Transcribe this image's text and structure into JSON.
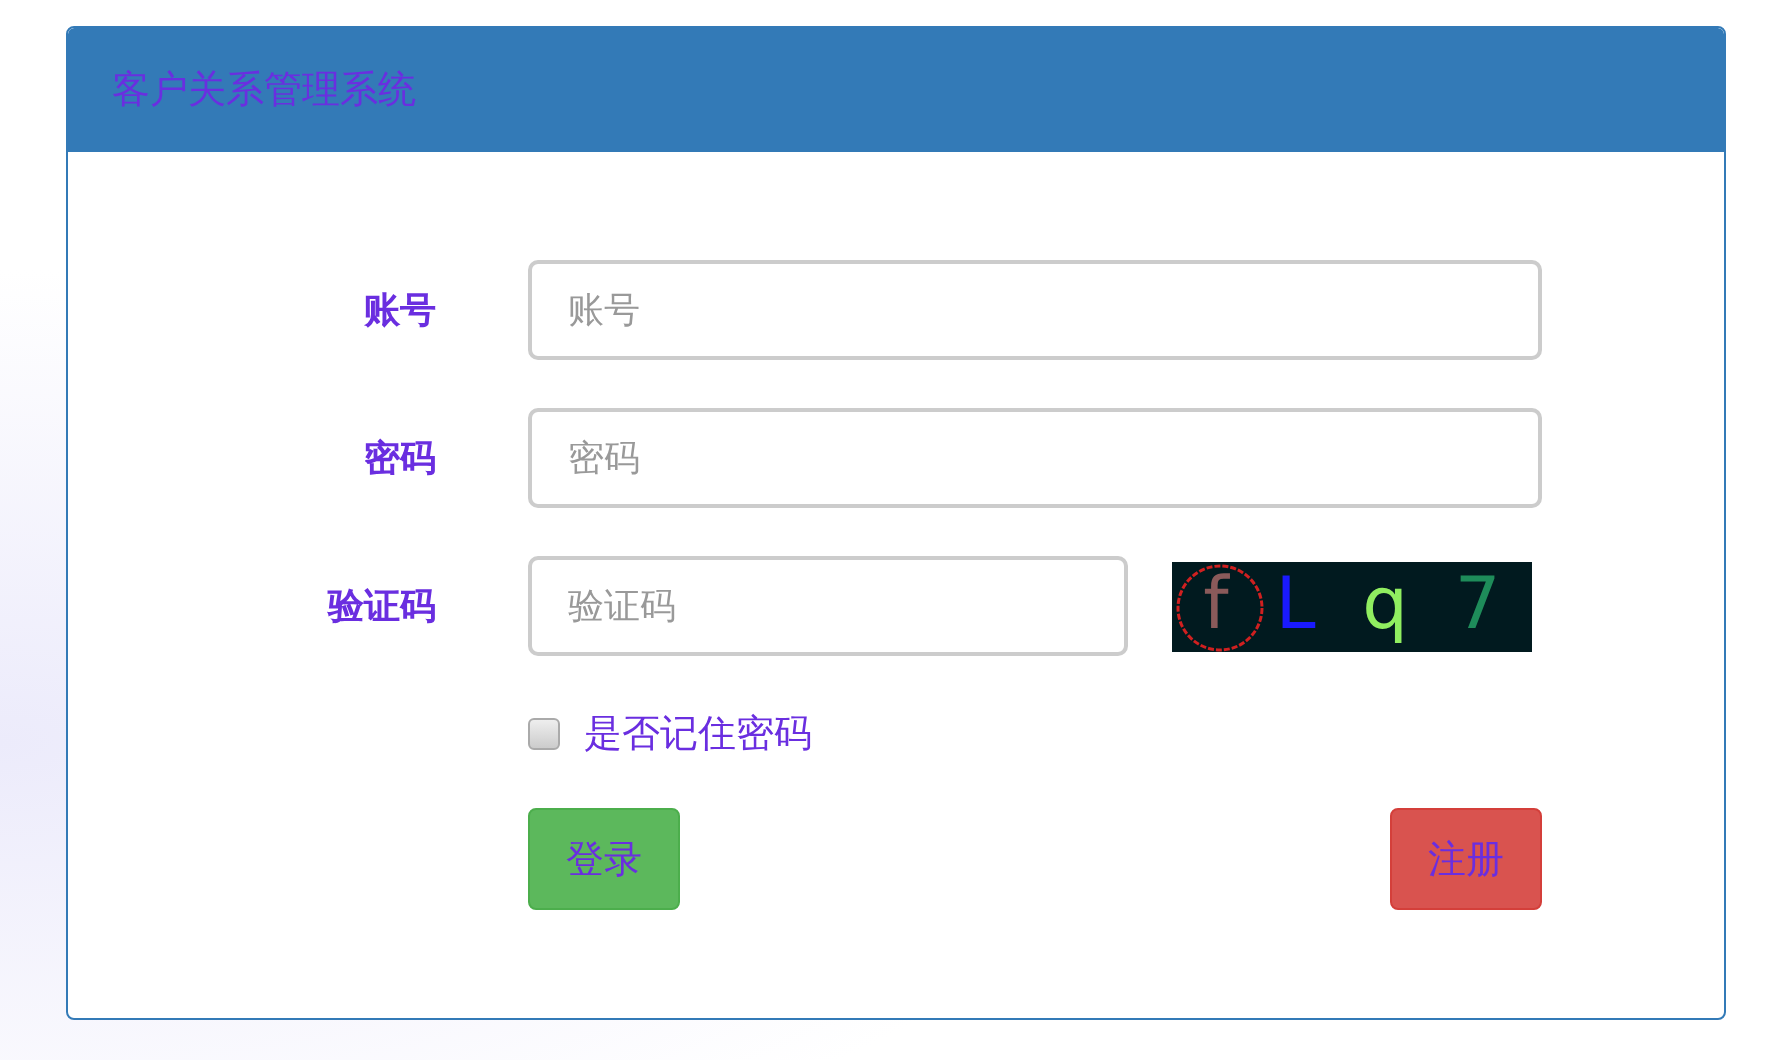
{
  "header": {
    "title": "客户关系管理系统"
  },
  "fields": [
    {
      "label": "账号",
      "placeholder": "账号",
      "kind": "text"
    },
    {
      "label": "密码",
      "placeholder": "密码",
      "kind": "password"
    },
    {
      "label": "验证码",
      "placeholder": "验证码",
      "kind": "captcha"
    }
  ],
  "captcha": [
    {
      "char": "f",
      "color": "#8a5a5a"
    },
    {
      "char": "L",
      "color": "#1a1aff"
    },
    {
      "char": "q",
      "color": "#90ee60"
    },
    {
      "char": "7",
      "color": "#1e8c5a"
    }
  ],
  "remember": {
    "label": "是否记住密码",
    "checked": false
  },
  "buttons": [
    {
      "label": "登录",
      "kind": "success"
    },
    {
      "label": "注册",
      "kind": "danger"
    }
  ]
}
